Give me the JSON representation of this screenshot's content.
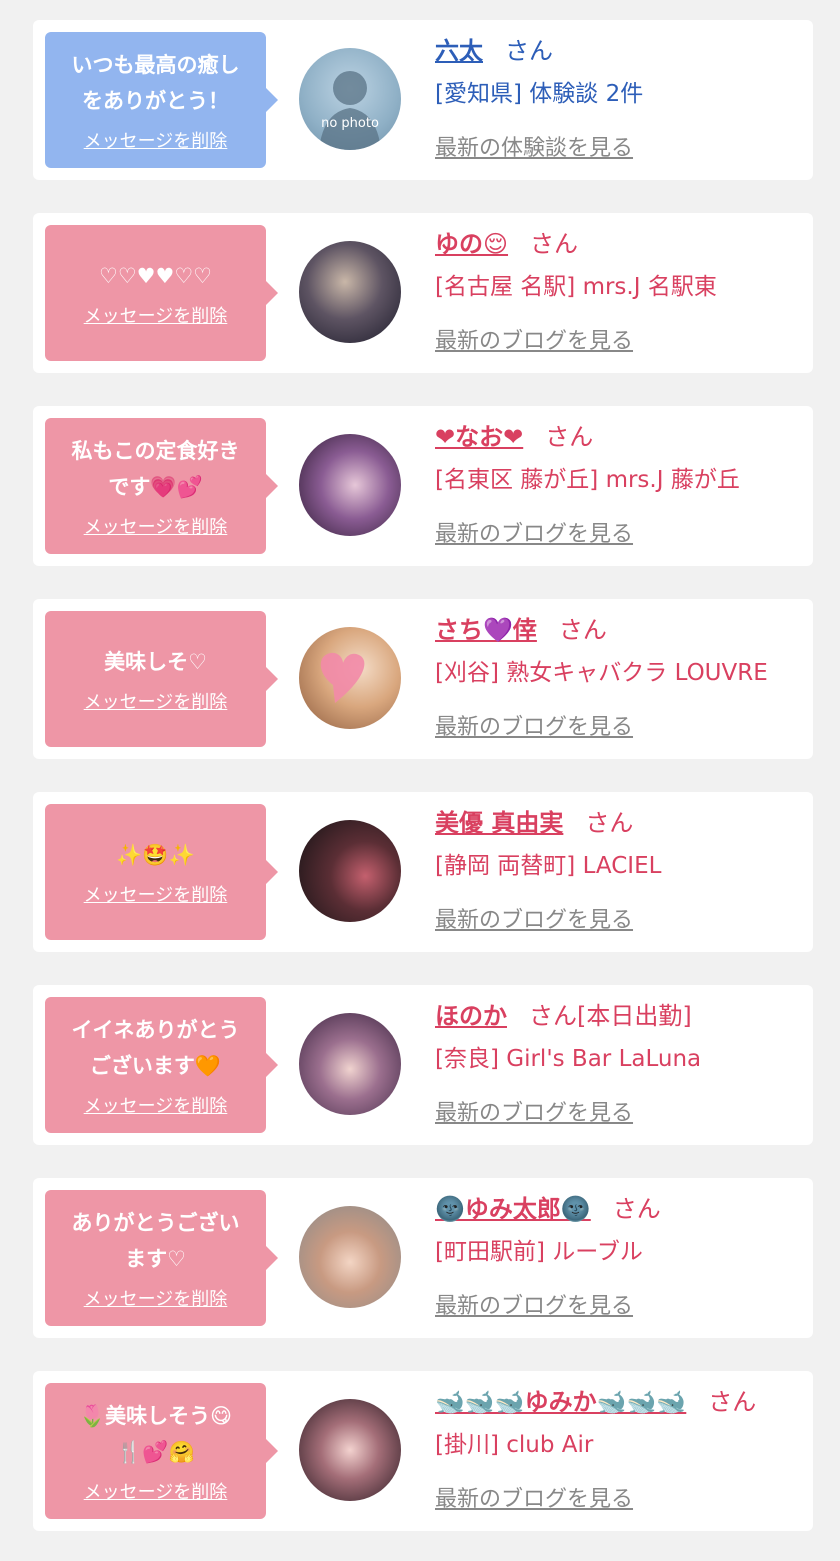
{
  "delete_label": "メッセージを削除",
  "colors": {
    "blue_bubble": "#92b5ef",
    "pink_bubble": "#ee96a6",
    "blue_text": "#2d5eb8",
    "pink_text": "#d94060"
  },
  "cards": [
    {
      "message": "いつも最高の癒し\nをありがとう！",
      "name": "六太",
      "san": "さん",
      "shop": "[愛知県] 体験談 2件",
      "more": "最新の体験談を見る",
      "avatar_text": "no photo"
    },
    {
      "message": "♡♡♥♥♡♡",
      "name": "ゆの😌",
      "san": "さん",
      "shop": "[名古屋 名駅] mrs.J 名駅東",
      "more": "最新のブログを見る"
    },
    {
      "message": "私もこの定食好き\nです💗💕",
      "name": "❤なお❤",
      "san": "さん",
      "shop": "[名東区 藤が丘] mrs.J 藤が丘",
      "more": "最新のブログを見る"
    },
    {
      "message": "美味しそ♡",
      "name": "さち💜倖",
      "san": "さん",
      "shop": "[刈谷] 熟女キャバクラ LOUVRE",
      "more": "最新のブログを見る"
    },
    {
      "message": "✨🤩✨",
      "name": "美優 真由実",
      "san": "さん",
      "shop": "[静岡 両替町] LACIEL",
      "more": "最新のブログを見る"
    },
    {
      "message": "イイネありがとう\nございます🧡",
      "name": "ほのか",
      "san": "さん[本日出勤]",
      "shop": "[奈良] Girl's Bar LaLuna",
      "more": "最新のブログを見る"
    },
    {
      "message": "ありがとうござい\nます♡",
      "name": "🌚ゆみ太郎🌚",
      "san": "さん",
      "shop": "[町田駅前] ルーブル",
      "more": "最新のブログを見る"
    },
    {
      "message": "🌷美味しそう😋\n🍴💕🤗",
      "name": "🐋🐋🐋ゆみか🐋🐋🐋",
      "san": "さん",
      "shop": "[掛川] club Air",
      "more": "最新のブログを見る"
    }
  ]
}
